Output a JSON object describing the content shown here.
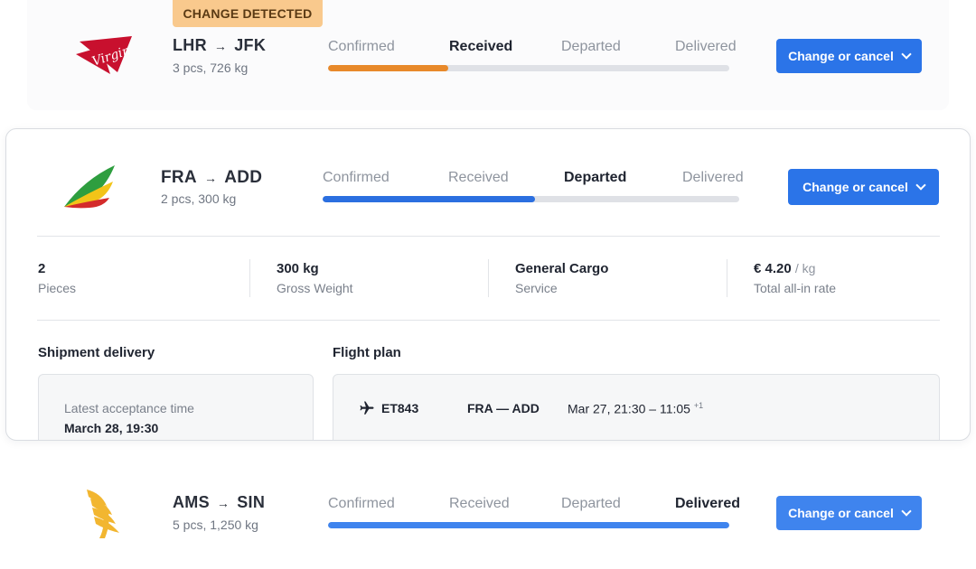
{
  "shipments": [
    {
      "badge": "CHANGE DETECTED",
      "airline_logo": "virgin-atlantic-logo",
      "origin": "LHR",
      "destination": "JFK",
      "summary": "3 pcs, 726 kg",
      "steps": [
        "Confirmed",
        "Received",
        "Departed",
        "Delivered"
      ],
      "active_step": "Received",
      "progress": 0.3,
      "progress_color": "#e8892a",
      "action_label": "Change or cancel"
    },
    {
      "airline_logo": "ethiopian-airlines-logo",
      "origin": "FRA",
      "destination": "ADD",
      "summary": "2 pcs, 300 kg",
      "steps": [
        "Confirmed",
        "Received",
        "Departed",
        "Delivered"
      ],
      "active_step": "Departed",
      "progress": 0.51,
      "progress_color": "#2b6fe0",
      "action_label": "Change or cancel",
      "details": {
        "pieces": {
          "value": "2",
          "label": "Pieces"
        },
        "weight": {
          "value": "300 kg",
          "label": "Gross Weight"
        },
        "service": {
          "value": "General Cargo",
          "label": "Service"
        },
        "rate": {
          "value": "€ 4.20",
          "unit": "/ kg",
          "label": "Total all-in rate"
        }
      },
      "delivery": {
        "title": "Shipment delivery",
        "acceptance_label": "Latest acceptance time",
        "acceptance_value": "March 28, 19:30"
      },
      "flight_plan": {
        "title": "Flight plan",
        "flights": [
          {
            "icon": "plane-icon",
            "number": "ET843",
            "route": "FRA — ADD",
            "time": "Mar 27, 21:30 – 11:05",
            "day_offset": "+1"
          }
        ]
      }
    },
    {
      "airline_logo": "singapore-airlines-logo",
      "origin": "AMS",
      "destination": "SIN",
      "summary": "5 pcs, 1,250 kg",
      "steps": [
        "Confirmed",
        "Received",
        "Departed",
        "Delivered"
      ],
      "active_step": "Delivered",
      "progress": 1.0,
      "progress_color": "#3f84ee",
      "action_label": "Change or cancel"
    }
  ]
}
